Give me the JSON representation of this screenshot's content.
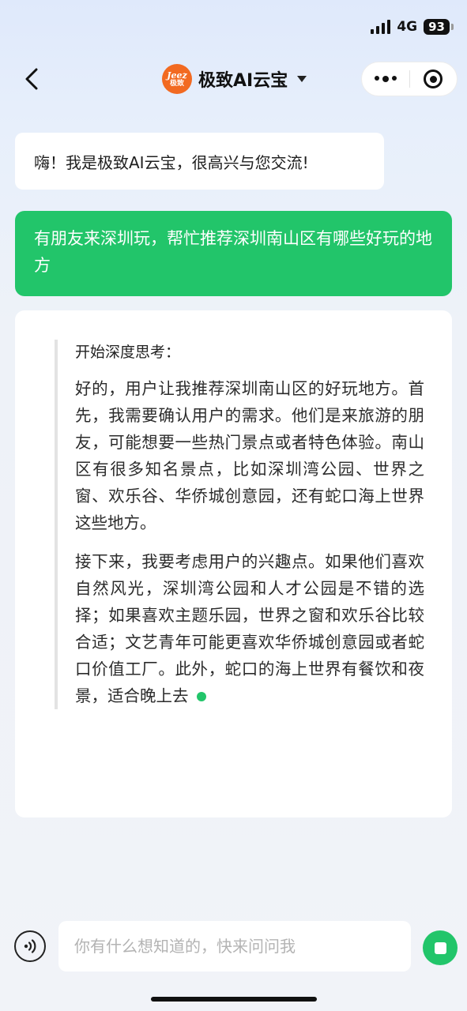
{
  "status_bar": {
    "network": "4G",
    "battery": "93"
  },
  "nav": {
    "logo_text_top": "Jeez",
    "logo_text_bottom": "极致",
    "title": "极致AI云宝",
    "icons": {
      "back": "chevron-left-icon",
      "more": "more-dots-icon",
      "close": "target-close-icon",
      "dropdown": "caret-down-icon"
    }
  },
  "chat": {
    "greeting": "嗨！我是极致AI云宝，很高兴与您交流!",
    "user_message": "有朋友来深圳玩，帮忙推荐深圳南山区有哪些好玩的地方",
    "answer": {
      "thinking_title": "开始深度思考：",
      "paragraphs": [
        "好的，用户让我推荐深圳南山区的好玩地方。首先，我需要确认用户的需求。他们是来旅游的朋友，可能想要一些热门景点或者特色体验。南山区有很多知名景点，比如深圳湾公园、世界之窗、欢乐谷、华侨城创意园，还有蛇口海上世界这些地方。",
        "接下来，我要考虑用户的兴趣点。如果他们喜欢自然风光，深圳湾公园和人才公园是不错的选择；如果喜欢主题乐园，世界之窗和欢乐谷比较合适；文艺青年可能更喜欢华侨城创意园或者蛇口价值工厂。此外，蛇口的海上世界有餐饮和夜景，适合晚上去"
      ]
    }
  },
  "input": {
    "placeholder": "你有什么想知道的，快来问问我",
    "value": "",
    "icons": {
      "voice": "voice-icon",
      "stop": "stop-icon"
    }
  },
  "colors": {
    "accent": "#22c56a",
    "logo": "#f26a21"
  }
}
